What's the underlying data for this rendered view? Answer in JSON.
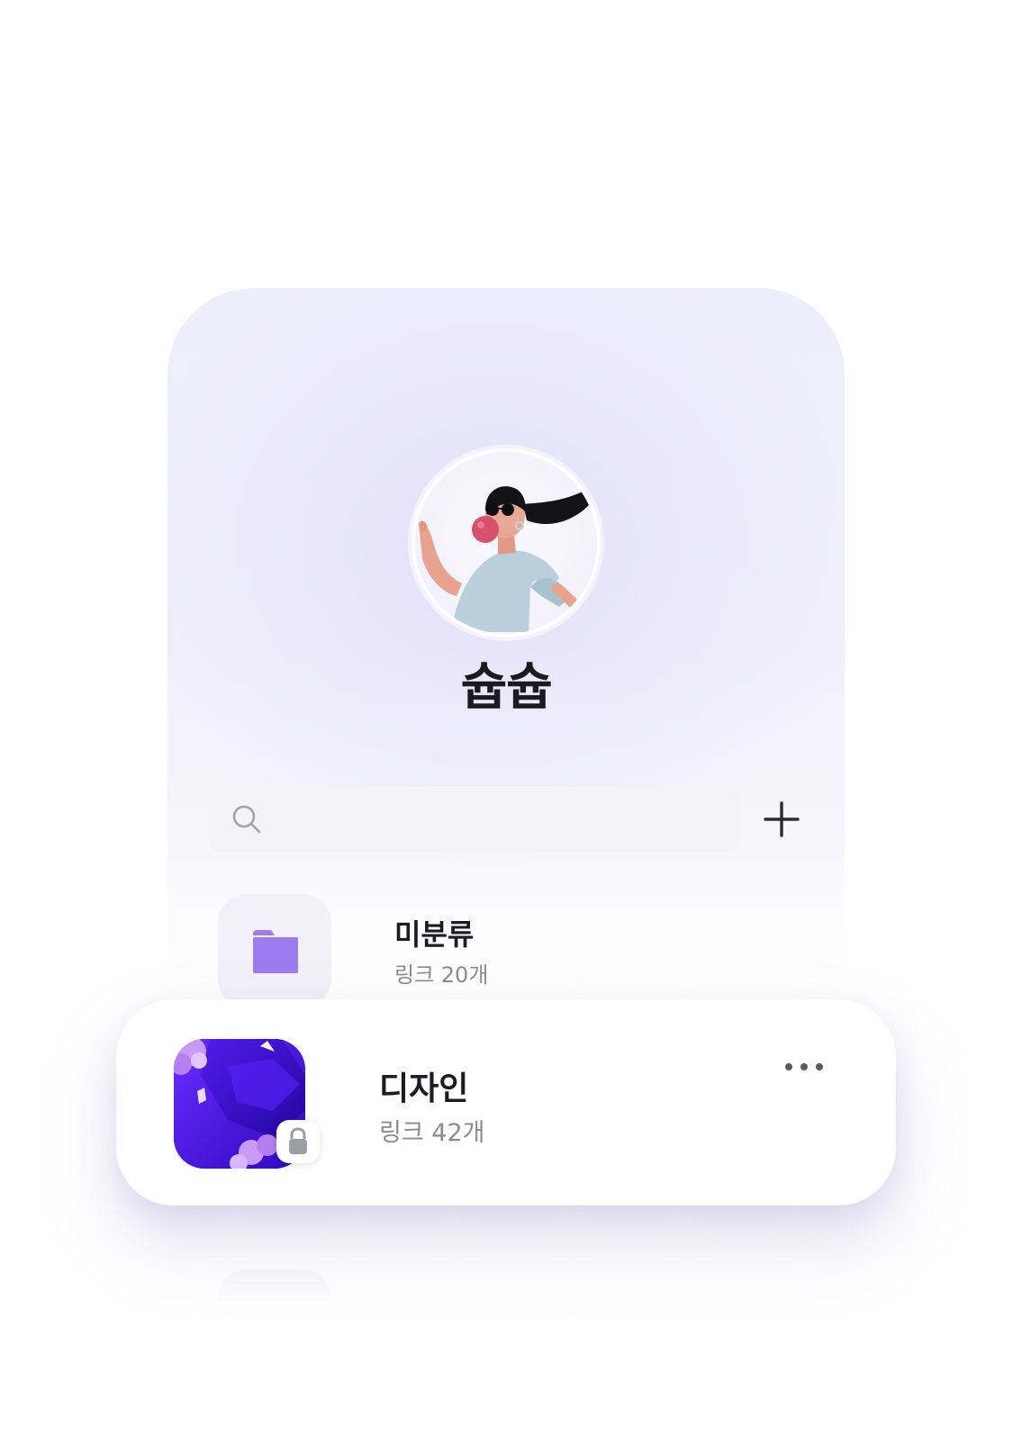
{
  "profile": {
    "username": "슙슙",
    "avatar_icon": "avatar-bubblegum-character"
  },
  "search": {
    "placeholder": "",
    "icon": "search-icon"
  },
  "toolbar": {
    "add_icon": "plus-icon"
  },
  "folders": [
    {
      "title": "미분류",
      "subtitle": "링크 20개",
      "icon": "folder-icon",
      "icon_color": "#9b7df0"
    }
  ],
  "highlighted_folder": {
    "title": "디자인",
    "subtitle": "링크 42개",
    "thumbnail_icon": "purple-crystal-thumbnail",
    "badge_icon": "lock-icon",
    "more_icon": "more-horizontal-icon"
  },
  "colors": {
    "accent": "#5a1ff0",
    "folder": "#9b7df0"
  }
}
